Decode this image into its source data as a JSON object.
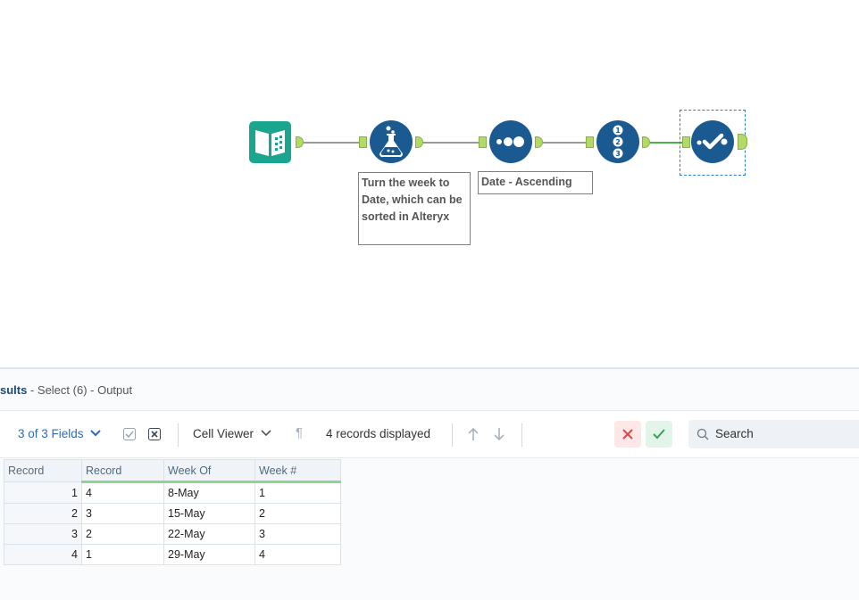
{
  "workflow": {
    "tools": [
      {
        "name": "input-data",
        "icon": "book-icon"
      },
      {
        "name": "formula",
        "icon": "flask-icon"
      },
      {
        "name": "sort",
        "icon": "dots-icon"
      },
      {
        "name": "record-id",
        "icon": "numbered-list-icon"
      },
      {
        "name": "select",
        "icon": "check-dots-icon"
      }
    ],
    "annotations": {
      "formula": "Turn the week to Date, which can be sorted in Alteryx",
      "sort": "Date - Ascending"
    }
  },
  "results": {
    "title_bold": "sults",
    "title_rest": " - Select (6) - Output",
    "fields_label": "3 of 3 Fields",
    "cell_viewer_label": "Cell Viewer",
    "records_displayed": "4 records displayed",
    "search_placeholder": "Search",
    "columns": [
      "Record",
      "Record",
      "Week Of",
      "Week #"
    ],
    "rows": [
      [
        "1",
        "4",
        "8-May",
        "1"
      ],
      [
        "2",
        "3",
        "15-May",
        "2"
      ],
      [
        "3",
        "2",
        "22-May",
        "3"
      ],
      [
        "4",
        "1",
        "29-May",
        "4"
      ]
    ]
  },
  "colors": {
    "tool_blue": "#1b5a91",
    "input_teal": "#1aa58f",
    "anchor_green": "#b3d96a",
    "link_blue": "#2e6db4"
  }
}
